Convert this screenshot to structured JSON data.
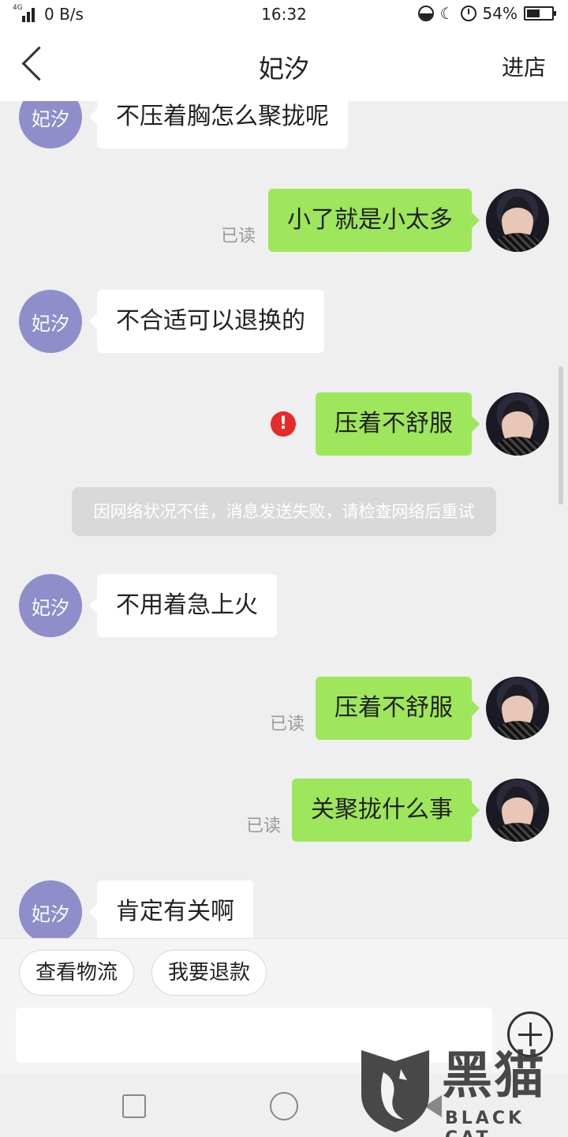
{
  "status_bar": {
    "network_type": "4G",
    "speed": "0 B/s",
    "time": "16:32",
    "battery_percent": "54%",
    "battery_level": 0.54
  },
  "nav": {
    "title": "妃汐",
    "enter_shop_label": "进店"
  },
  "chat": {
    "shop_avatar_label": "妃汐",
    "read_label": "已读",
    "fail_mark": "!",
    "messages": [
      {
        "sender": "shop",
        "text": "不压着胸怎么聚拢呢"
      },
      {
        "sender": "user",
        "text": "小了就是小太多",
        "status": "已读"
      },
      {
        "sender": "shop",
        "text": "不合适可以退换的"
      },
      {
        "sender": "user",
        "text": "压着不舒服",
        "status": "failed"
      },
      {
        "sender": "system",
        "text": "因网络状况不佳，消息发送失败，请检查网络后重试"
      },
      {
        "sender": "shop",
        "text": "不用着急上火"
      },
      {
        "sender": "user",
        "text": "压着不舒服",
        "status": "已读"
      },
      {
        "sender": "user",
        "text": "关聚拢什么事",
        "status": "已读"
      },
      {
        "sender": "shop",
        "text": "肯定有关啊"
      }
    ]
  },
  "quick_actions": {
    "track_logistics": "查看物流",
    "request_refund": "我要退款"
  },
  "input": {
    "placeholder": ""
  },
  "watermark": {
    "title": "黑猫",
    "subtitle": "BLACK CAT"
  },
  "colors": {
    "user_bubble": "#9ee65b",
    "shop_avatar": "#8f8ecb",
    "fail_icon": "#e52a2a"
  }
}
